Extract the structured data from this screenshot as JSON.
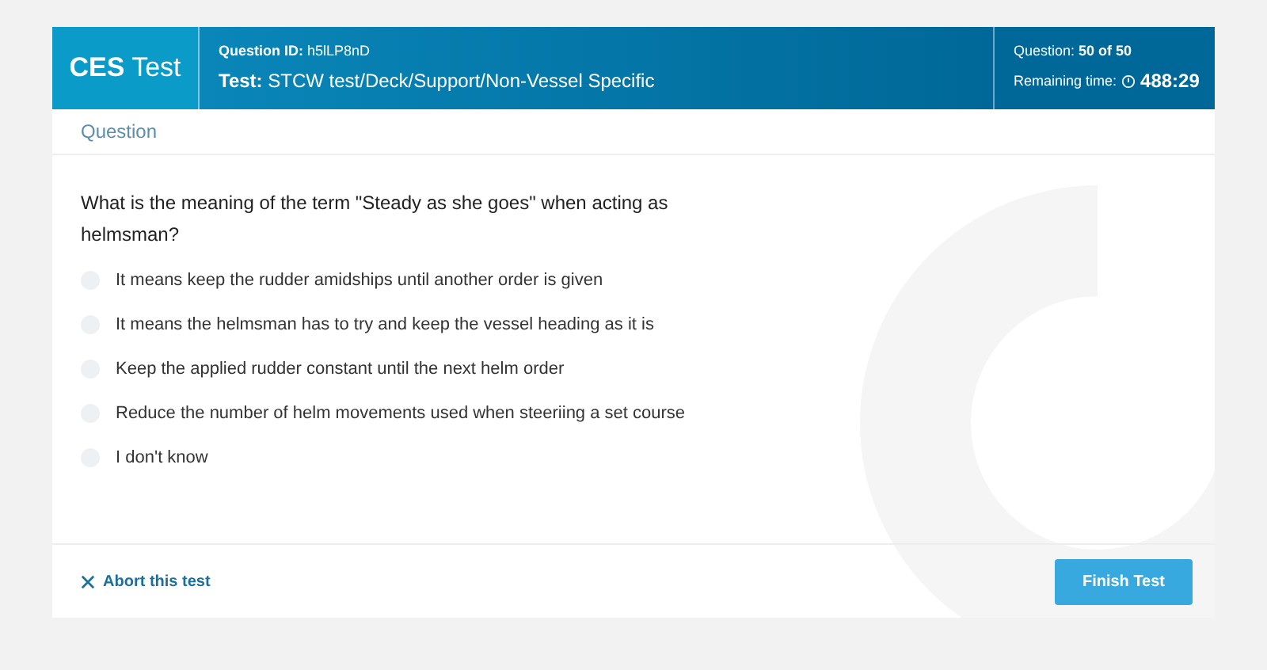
{
  "header": {
    "logo": "**CES** Test",
    "question_id": "**Question ID:** h5lLP8nD",
    "test": "**Test:** STCW test/Deck/Support/Non-Vessel Specific",
    "progress": "Question: **50 of 50**",
    "remaining_label": "Remaining time:",
    "remaining_time": "488:29"
  },
  "section_label": "Question",
  "question": "What is the meaning of the term \"Steady as she goes\" when acting as helmsman?",
  "options": [
    {
      "label": "It means keep the rudder amidships until another order is given",
      "selected": false
    },
    {
      "label": "It means the helmsman has to try and keep the vessel heading as it is",
      "selected": false
    },
    {
      "label": "Keep the applied rudder constant until the next helm order",
      "selected": false
    },
    {
      "label": "Reduce the number of helm movements used when steeriing a set course",
      "selected": false
    },
    {
      "label": "I don't know",
      "selected": false
    }
  ],
  "footer": {
    "abort": "Abort this test",
    "finish": "Finish Test"
  }
}
